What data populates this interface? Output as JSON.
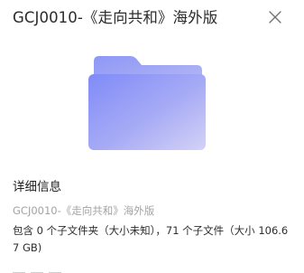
{
  "header": {
    "title": "GCJ0010-《走向共和》海外版",
    "close_icon": "close-icon"
  },
  "preview": {
    "icon": "folder-icon",
    "colors": {
      "back": "#9ba4f5",
      "front_start": "#7f8bf8",
      "front_end": "#d4d2f6"
    }
  },
  "details": {
    "section_title": "详细信息",
    "file_name": "GCJ0010-《走向共和》海外版",
    "summary": "包含 0 个子文件夹（大小未知），71 个子文件（大小 106.67 GB)"
  }
}
